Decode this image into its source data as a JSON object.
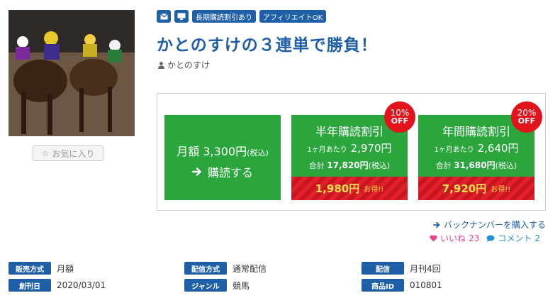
{
  "tags": {
    "mail_icon": "mail-icon",
    "device_icon": "monitor-icon",
    "long_term": "長期購読割引あり",
    "affiliate": "アフィリエイトOK"
  },
  "title": "かとのすけの３連単で勝負！",
  "author": "かとのすけ",
  "favorite_label": "お気に入り",
  "plans": {
    "monthly": {
      "price": "月額 3,300円",
      "tax": "(税込)",
      "cta": "購読する"
    },
    "half": {
      "name": "半年購読割引",
      "per_month_label": "1ヶ月あたり",
      "per_month": "2,970円",
      "total_label": "合計",
      "total": "17,820円",
      "total_tax": "(税込)",
      "savings": "1,980円",
      "savings_label": "お得!!",
      "badge_pct": "10%",
      "badge_off": "OFF"
    },
    "year": {
      "name": "年間購読割引",
      "per_month_label": "1ヶ月あたり",
      "per_month": "2,640円",
      "total_label": "合計",
      "total": "31,680円",
      "total_tax": "(税込)",
      "savings": "7,920円",
      "savings_label": "お得!!",
      "badge_pct": "20%",
      "badge_off": "OFF"
    }
  },
  "backnumber": "バックナンバーを購入する",
  "social": {
    "like_label": "いいね",
    "like_count": "23",
    "comment_label": "コメント",
    "comment_count": "2"
  },
  "meta": {
    "sales_type_label": "販売方式",
    "sales_type": "月額",
    "delivery_type_label": "配信方式",
    "delivery_type": "通常配信",
    "delivery_label": "配信",
    "delivery": "月刊4回",
    "founded_label": "創刊日",
    "founded": "2020/03/01",
    "genre_label": "ジャンル",
    "genre": "競馬",
    "product_id_label": "商品ID",
    "product_id": "010801"
  },
  "colors": {
    "brand_blue": "#1f5fa8",
    "plan_green": "#2aa63d",
    "badge_red": "#e2131c",
    "like_pink": "#e8448a"
  }
}
